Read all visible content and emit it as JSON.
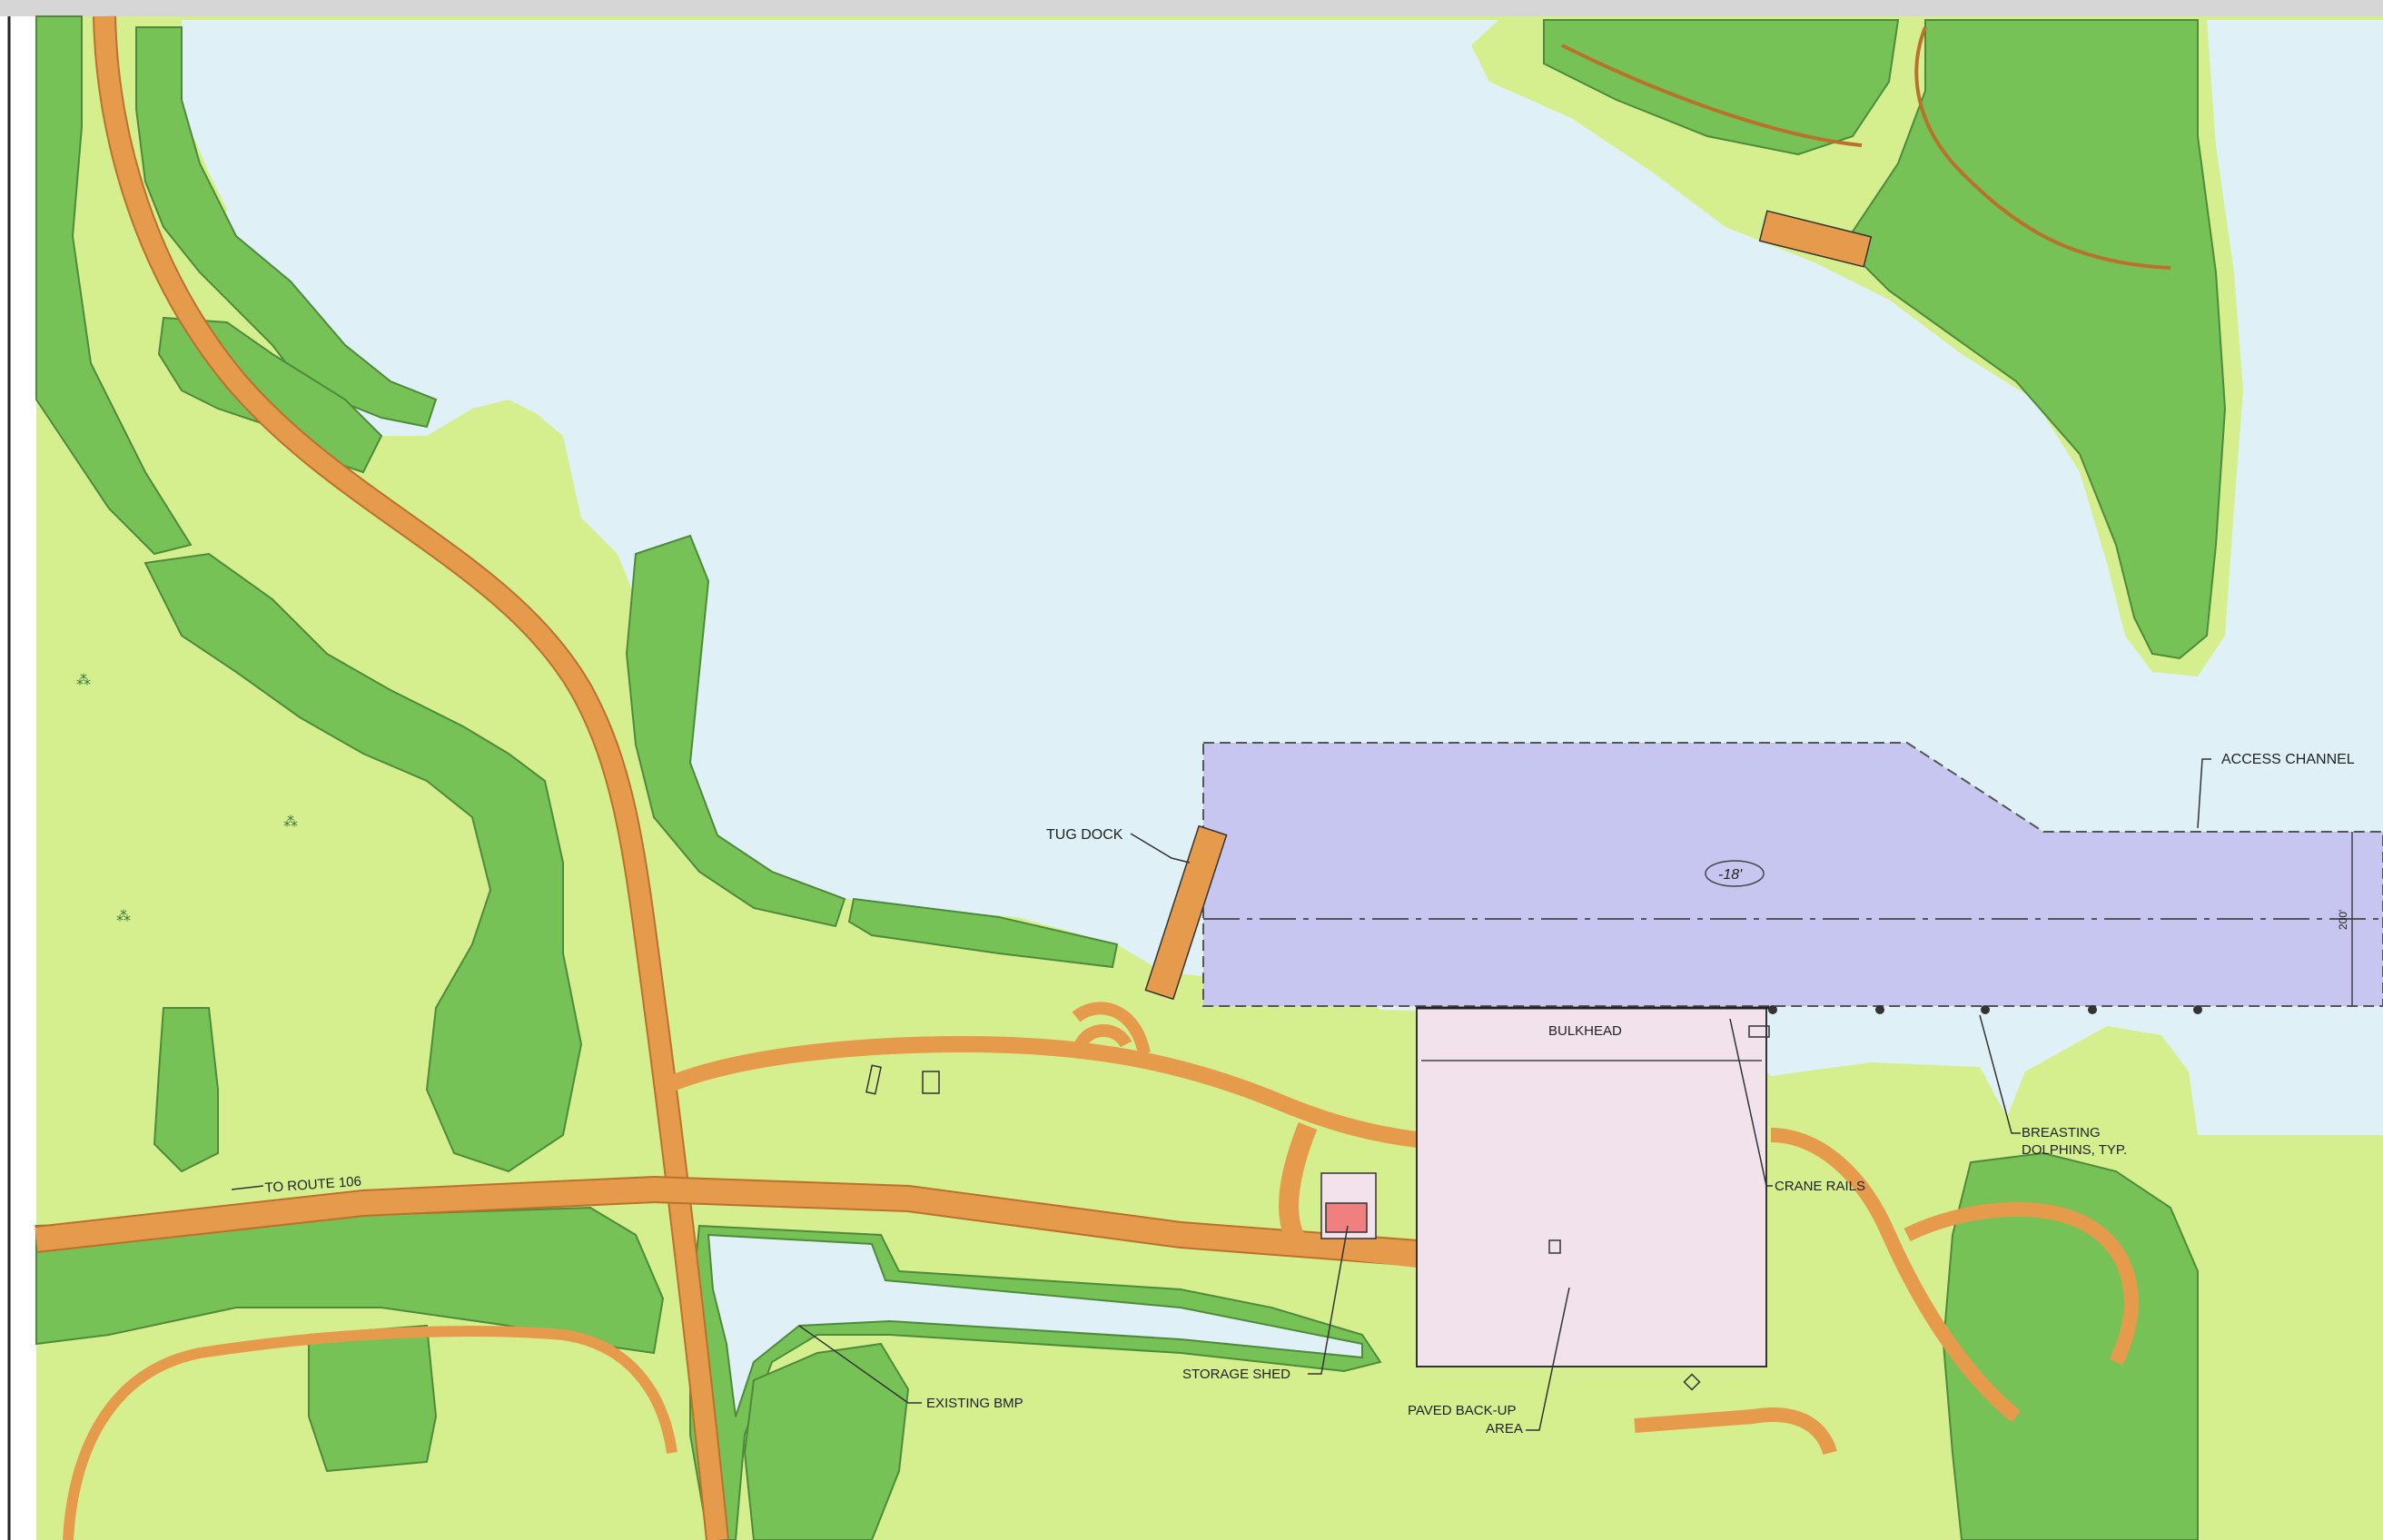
{
  "colors": {
    "water": "#dff1f7",
    "grass": "#d5ef8e",
    "vegetation": "#76c256",
    "vegetation_edge": "#4f8a3a",
    "road": "#e69a4b",
    "road_edge": "#b9712c",
    "channel": "#c7c6f1",
    "backup_area": "#f1e2ec",
    "shed": "#f08080",
    "outline": "#333333"
  },
  "labels": {
    "access_channel": "ACCESS CHANNEL",
    "depth": "-18'",
    "width_dim": "200'",
    "tug_dock": "TUG DOCK",
    "bulkhead": "BULKHEAD",
    "crane_rails": "CRANE RAILS",
    "breasting_dolphins_l1": "BREASTING",
    "breasting_dolphins_l2": "DOLPHINS, TYP.",
    "to_route": "TO ROUTE 106",
    "existing_bmp": "EXISTING BMP",
    "storage_shed": "STORAGE SHED",
    "paved_backup_l1": "PAVED BACK-UP",
    "paved_backup_l2": "AREA"
  },
  "icons": {
    "marsh_symbol": "marsh-grass-icon",
    "dolphin_marker": "mooring-dolphin-icon"
  }
}
